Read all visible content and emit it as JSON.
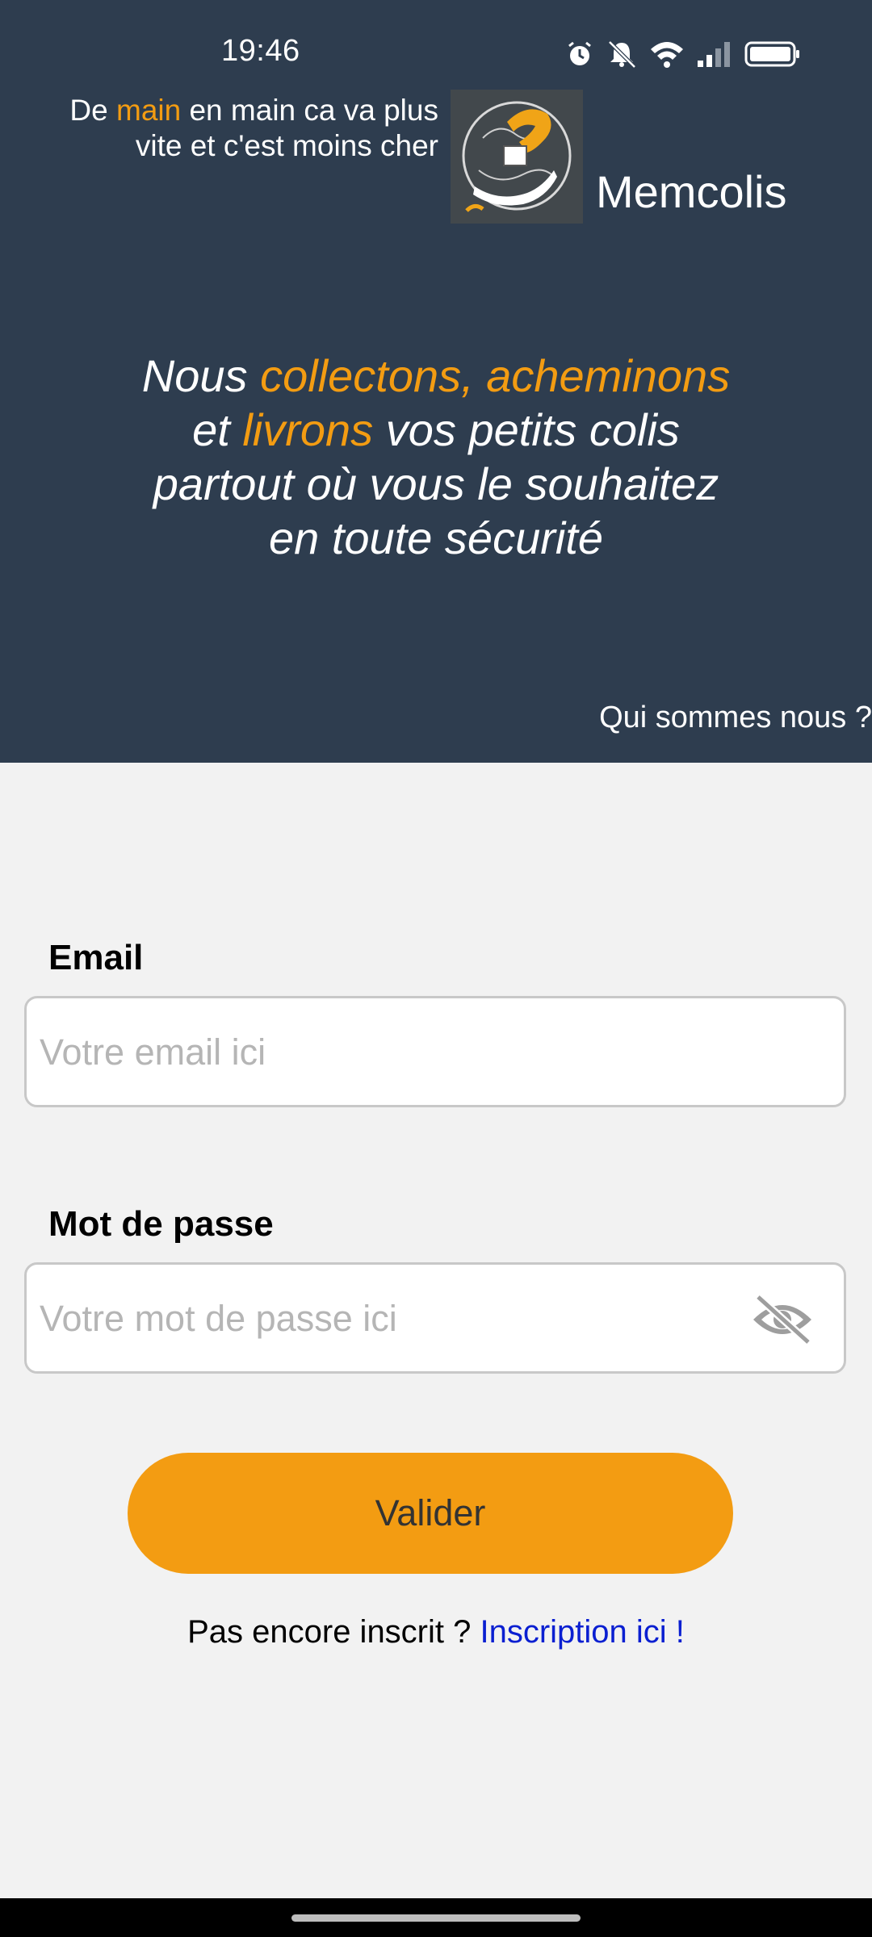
{
  "status_bar": {
    "time": "19:46",
    "icons": [
      "alarm-icon",
      "bell-muted-icon",
      "wifi-icon",
      "signal-icon",
      "battery-icon"
    ]
  },
  "header": {
    "tagline_part1": "De ",
    "tagline_highlight": "main",
    "tagline_part2": " en main ca va plus",
    "tagline_line2": "vite et c'est moins cher",
    "brand_name": "Memcolis",
    "logo_icon": "hand-package-logo"
  },
  "hero": {
    "slogan": {
      "w1": "Nous ",
      "hl1": "collectons, acheminons",
      "w2": "et ",
      "hl2": "livrons",
      "w3": " vos petits colis",
      "line3": "partout où vous le souhaitez",
      "line4": "en toute sécurité"
    },
    "about_link": "Qui sommes nous ?"
  },
  "form": {
    "email_label": "Email",
    "email_value": "",
    "email_placeholder": "Votre email ici",
    "password_label": "Mot de passe",
    "password_value": "",
    "password_placeholder": "Votre mot de passe ici",
    "toggle_icon": "eye-off-icon",
    "submit_label": "Valider"
  },
  "signup": {
    "prompt": "Pas encore inscrit ? ",
    "link": "Inscription ici !"
  },
  "colors": {
    "header_bg": "#2e3d4f",
    "accent": "#f39c12",
    "link": "#0a1fd1",
    "page_bg": "#f2f2f2"
  }
}
